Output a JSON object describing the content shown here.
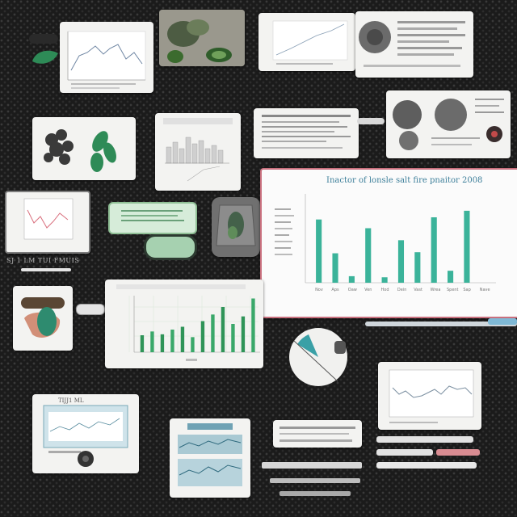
{
  "image_caption": "",
  "gallery": {
    "small_caption": "SJ 1 LM TUI FMUIS",
    "monitor_card_title": "TIJJ1 ML"
  },
  "main_chart": {
    "title_text": "Inactor of lonsle salt fire pnaitor 2008",
    "colors": {
      "bar": "#3bb39a",
      "accent": "#c96a78",
      "border": "#c9707e"
    }
  },
  "chart_data": [
    {
      "type": "bar",
      "title": "Inactor of lonsle salt fire pnaitor 2008",
      "categories": [
        "Nov",
        "Aps",
        "Oaw",
        "Ven",
        "Hod",
        "Dein",
        "Vast",
        "Wrea",
        "Spent",
        "Sap",
        "Nave"
      ],
      "values": [
        58,
        27,
        6,
        50,
        5,
        39,
        28,
        60,
        11,
        66,
        0
      ],
      "ylim": [
        0,
        80
      ]
    },
    {
      "type": "bar",
      "title": "",
      "values": [
        18,
        22,
        19,
        24,
        27,
        16,
        33,
        40,
        48,
        30,
        38,
        57
      ]
    }
  ],
  "icons": [
    "leaf-icon",
    "plant-icon",
    "avocado-icon",
    "toggle-switch-icon",
    "gauge-icon",
    "camera-icon"
  ]
}
